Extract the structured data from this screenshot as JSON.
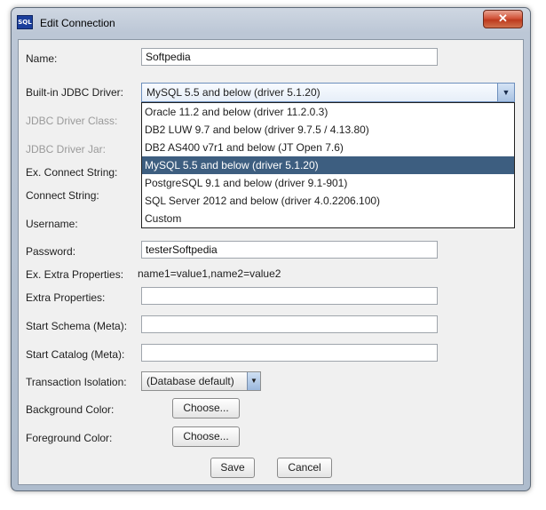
{
  "window": {
    "title": "Edit Connection",
    "app_icon": "SQL",
    "close_glyph": "✕"
  },
  "form": {
    "name_label": "Name:",
    "name_value": "Softpedia",
    "driver_label": "Built-in JDBC Driver:",
    "driver_class_label": "JDBC Driver Class:",
    "driver_jar_label": "JDBC Driver Jar:",
    "ex_connect_label": "Ex. Connect String:",
    "connect_label": "Connect String:",
    "username_label": "Username:",
    "password_label": "Password:",
    "password_value": "testerSoftpedia",
    "ex_extra_label": "Ex. Extra Properties:",
    "ex_extra_value": "name1=value1,name2=value2",
    "extra_label": "Extra Properties:",
    "schema_label": "Start Schema (Meta):",
    "catalog_label": "Start Catalog (Meta):",
    "isolation_label": "Transaction Isolation:",
    "isolation_value": "(Database default)",
    "bg_label": "Background Color:",
    "fg_label": "Foreground Color:",
    "choose_label": "Choose..."
  },
  "driver_select": {
    "selected": "MySQL 5.5 and below (driver 5.1.20)",
    "options": [
      "Oracle 11.2 and below (driver 11.2.0.3)",
      "DB2 LUW 9.7 and below (driver 9.7.5 / 4.13.80)",
      "DB2 AS400 v7r1 and below (JT Open 7.6)",
      "MySQL 5.5 and below (driver 5.1.20)",
      "PostgreSQL 9.1 and below (driver 9.1-901)",
      "SQL Server 2012 and below (driver 4.0.2206.100)",
      "Custom"
    ],
    "selected_index": 3
  },
  "buttons": {
    "save": "Save",
    "cancel": "Cancel"
  },
  "colors": {
    "selection": "#3d5e80",
    "frame": "#bcc7d6"
  }
}
